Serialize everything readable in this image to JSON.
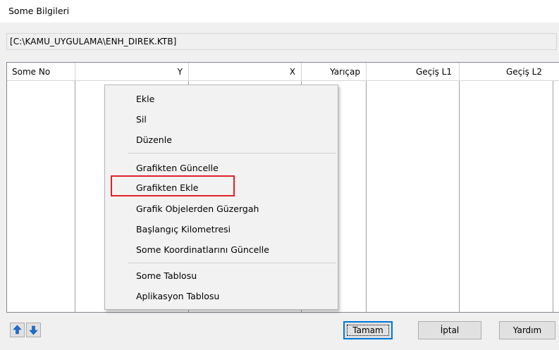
{
  "window": {
    "title": "Some Bilgileri"
  },
  "file_path": "[C:\\KAMU_UYGULAMA\\ENH_DIREK.KTB]",
  "table": {
    "columns": [
      "Some No",
      "Y",
      "X",
      "Yarıçap",
      "Geçiş L1",
      "Geçiş L2"
    ]
  },
  "context_menu": {
    "group1": [
      "Ekle",
      "Sil",
      "Düzenle"
    ],
    "group2": [
      "Grafikten Güncelle",
      "Grafikten Ekle",
      "Grafik Objelerden Güzergah",
      "Başlangıç Kilometresi",
      "Some Koordinatlarını Güncelle"
    ],
    "group3": [
      "Some Tablosu",
      "Aplikasyon Tablosu"
    ],
    "highlighted": "Grafikten Ekle"
  },
  "buttons": {
    "ok": "Tamam",
    "cancel": "İptal",
    "help": "Yardım"
  },
  "icons": {
    "move_up": "arrow-up-icon",
    "move_down": "arrow-down-icon"
  },
  "colors": {
    "arrow": "#1e6fd0",
    "highlight_box": "#e0202a",
    "default_button_border": "#0078d7"
  }
}
